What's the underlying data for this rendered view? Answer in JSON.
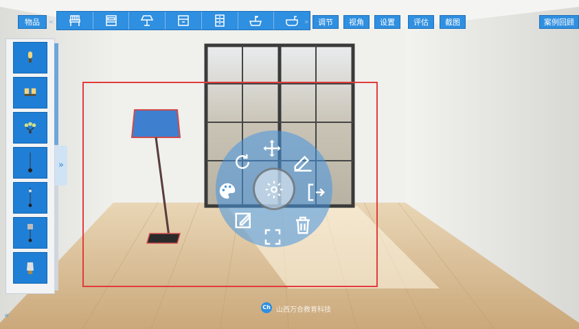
{
  "toolbar": {
    "items_label": "物品",
    "chevron_left": "«",
    "chevron_right": "»",
    "adjust_label": "调节",
    "view_label": "视角",
    "settings_label": "设置",
    "evaluate_label": "评估",
    "screenshot_label": "截图",
    "case_review_label": "案例回顾",
    "category_icons": [
      "chair-icon",
      "bed-icon",
      "lamp-icon",
      "cabinet-icon",
      "dresser-icon",
      "sink-icon",
      "bathtub-icon"
    ]
  },
  "sidebar": {
    "items": [
      "wall-sconce-icon",
      "double-wall-light-icon",
      "chandelier-icon",
      "pendant-lamp-icon",
      "pendant-lamp-small-icon",
      "pendant-lamp-shade-icon",
      "table-lamp-icon"
    ],
    "expand_glyph": "»",
    "collapse_glyph": "«"
  },
  "radial_menu": {
    "actions": [
      "rotate-icon",
      "move-icon",
      "measure-icon",
      "material-icon",
      "settings-icon",
      "exit-icon",
      "edit-icon",
      "scale-icon",
      "delete-icon"
    ]
  },
  "watermark": {
    "logo": "Ch",
    "text": "山西万合教育科技"
  },
  "colors": {
    "toolbar_blue": "#2f8fe0",
    "selection_red": "#e23a3a",
    "radial_blue": "#4696e1"
  }
}
